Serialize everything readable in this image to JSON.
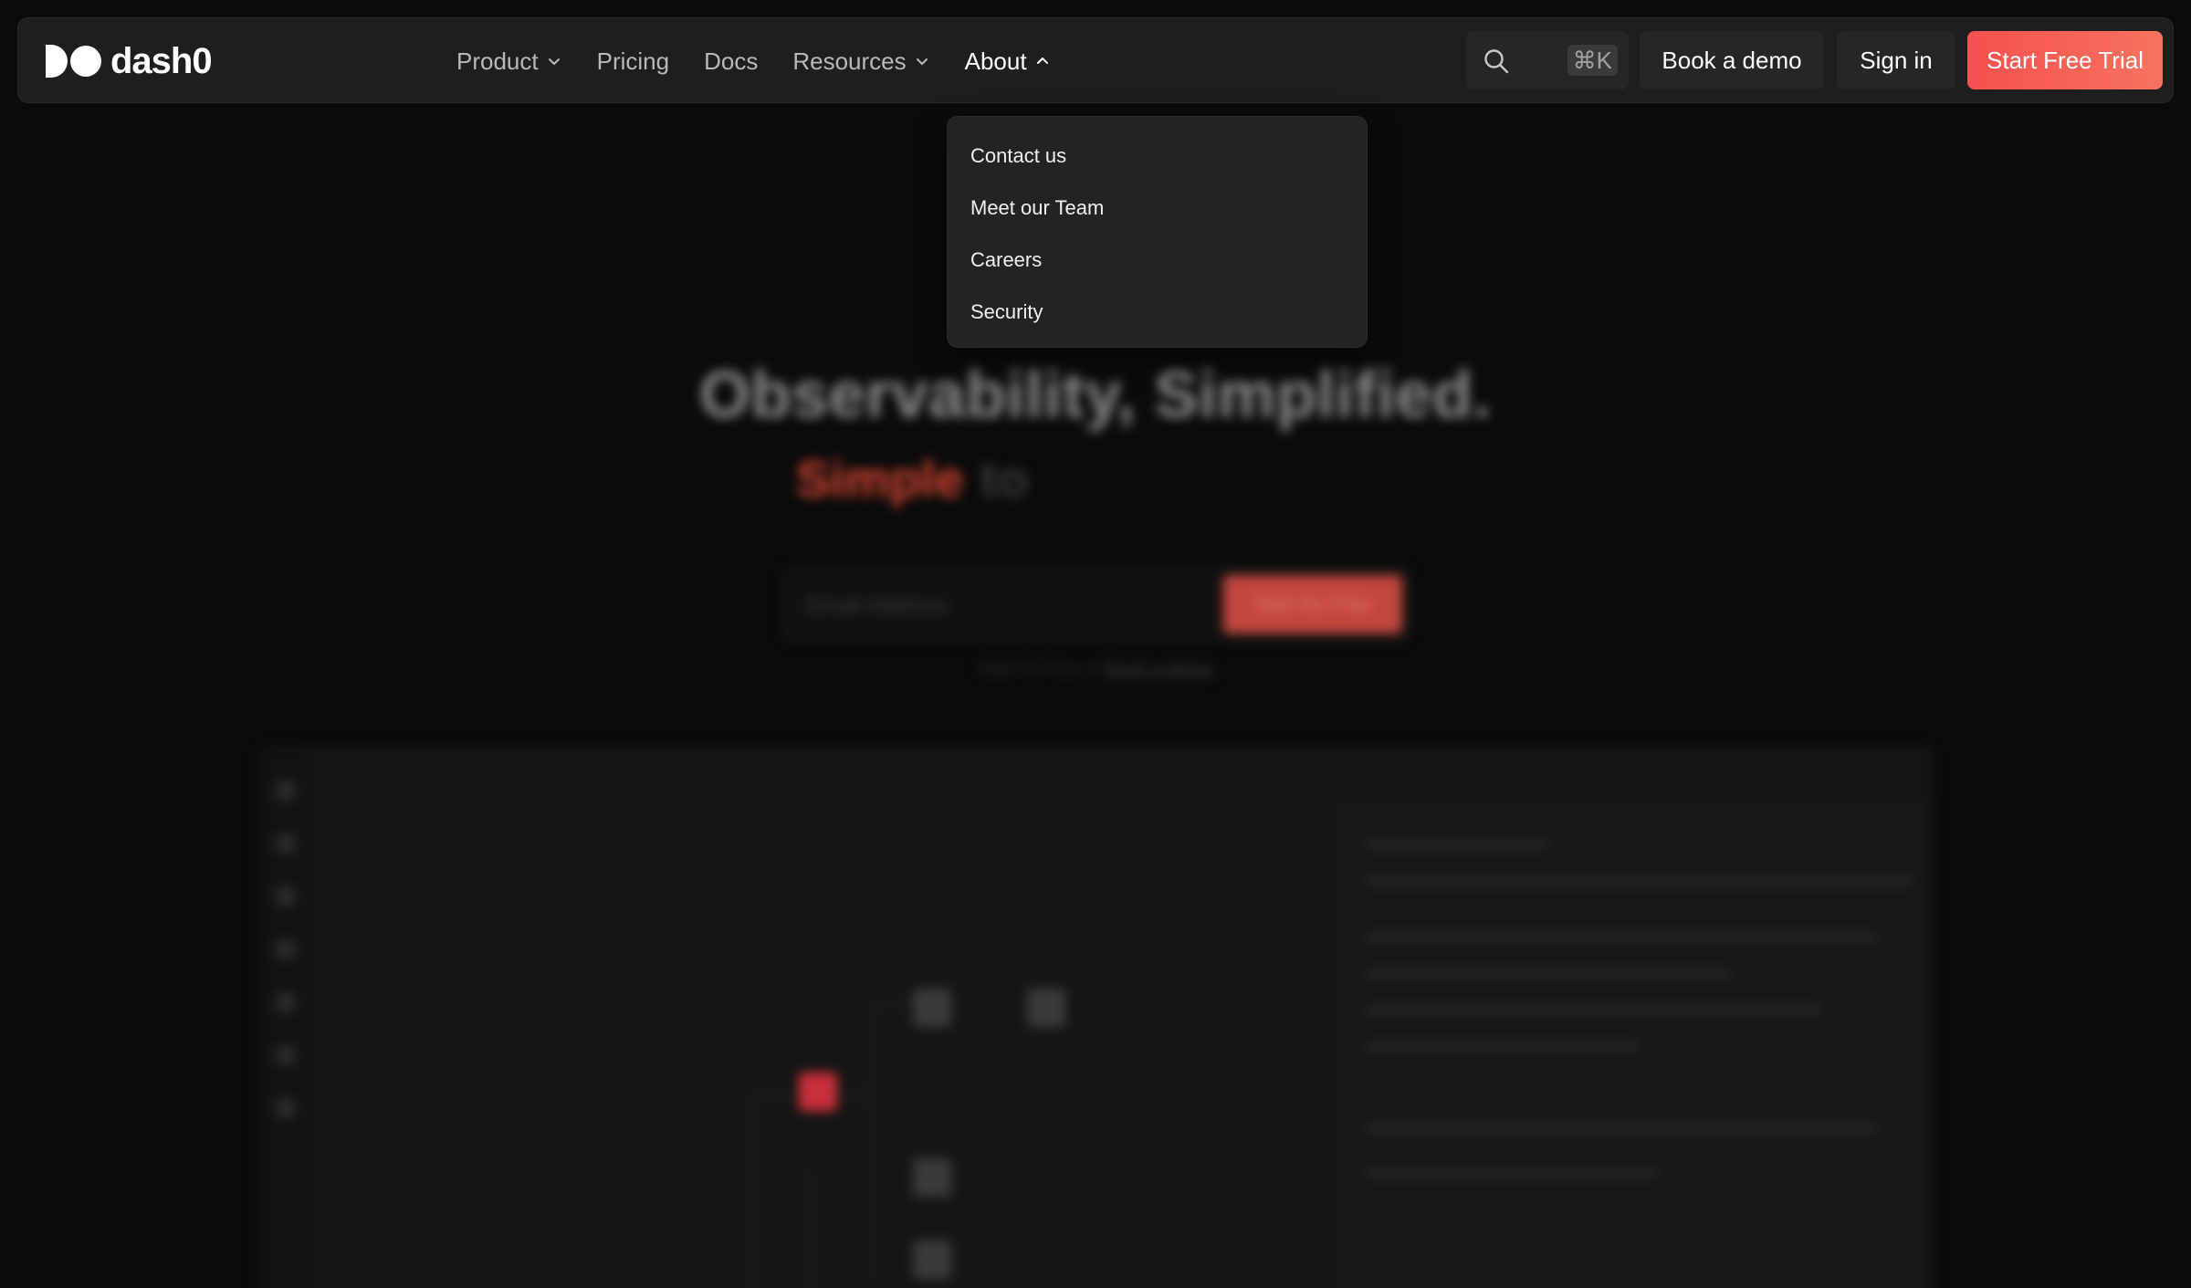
{
  "brand": {
    "name": "dash0"
  },
  "nav": {
    "links": [
      {
        "label": "Product",
        "has_menu": true
      },
      {
        "label": "Pricing",
        "has_menu": false
      },
      {
        "label": "Docs",
        "has_menu": false
      },
      {
        "label": "Resources",
        "has_menu": true
      },
      {
        "label": "About",
        "has_menu": true,
        "expanded": true
      }
    ],
    "search_shortcut": "⌘K",
    "book_demo": "Book a demo",
    "sign_in": "Sign in",
    "start_trial": "Start Free Trial"
  },
  "about_menu": {
    "items": [
      "Contact us",
      "Meet our Team",
      "Careers",
      "Security"
    ]
  },
  "hero": {
    "title": "Observability, Simplified.",
    "subtitle_highlight": "Simple",
    "subtitle_rest": "to",
    "email_placeholder": "Email Address",
    "cta": "Start for Free",
    "note_prefix": "Start for free or",
    "note_link": "Book a demo"
  },
  "colors": {
    "accent": "#f6504f",
    "nav_bg": "#1e1e1f",
    "page_bg": "#0b0b0c",
    "dropdown_bg": "#232324"
  }
}
